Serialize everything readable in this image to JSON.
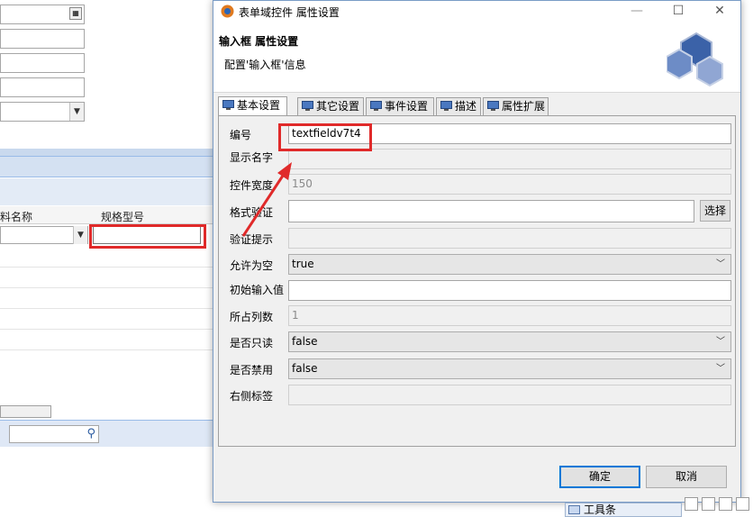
{
  "background": {
    "grid_headers": [
      "料名称",
      "规格型号"
    ]
  },
  "dialog": {
    "title": "表单域控件 属性设置",
    "minimize": "—",
    "maximize": "☐",
    "close": "✕",
    "header_title": "输入框 属性设置",
    "header_subtitle": "配置'输入框'信息"
  },
  "tabs": [
    {
      "label": "基本设置"
    },
    {
      "label": "其它设置"
    },
    {
      "label": "事件设置"
    },
    {
      "label": "描述"
    },
    {
      "label": "属性扩展"
    }
  ],
  "form": {
    "id_label": "编号",
    "id_value": "textfieldv7t4",
    "display_name_label": "显示名字",
    "display_name_value": "",
    "width_label": "控件宽度",
    "width_value": "150",
    "format_label": "格式验证",
    "format_value": "",
    "choose_label": "选择",
    "hint_label": "验证提示",
    "hint_value": "",
    "allow_empty_label": "允许为空",
    "allow_empty_value": "true",
    "initial_label": "初始输入值",
    "initial_value": "",
    "columns_label": "所占列数",
    "columns_value": "1",
    "readonly_label": "是否只读",
    "readonly_value": "false",
    "disabled_label": "是否禁用",
    "disabled_value": "false",
    "right_label_label": "右侧标签",
    "right_label_value": ""
  },
  "buttons": {
    "ok": "确定",
    "cancel": "取消"
  },
  "taskbar": {
    "toolbar_label": "工具条"
  },
  "colors": {
    "annotation_red": "#e02a2a",
    "primary_border": "#0078d7"
  }
}
